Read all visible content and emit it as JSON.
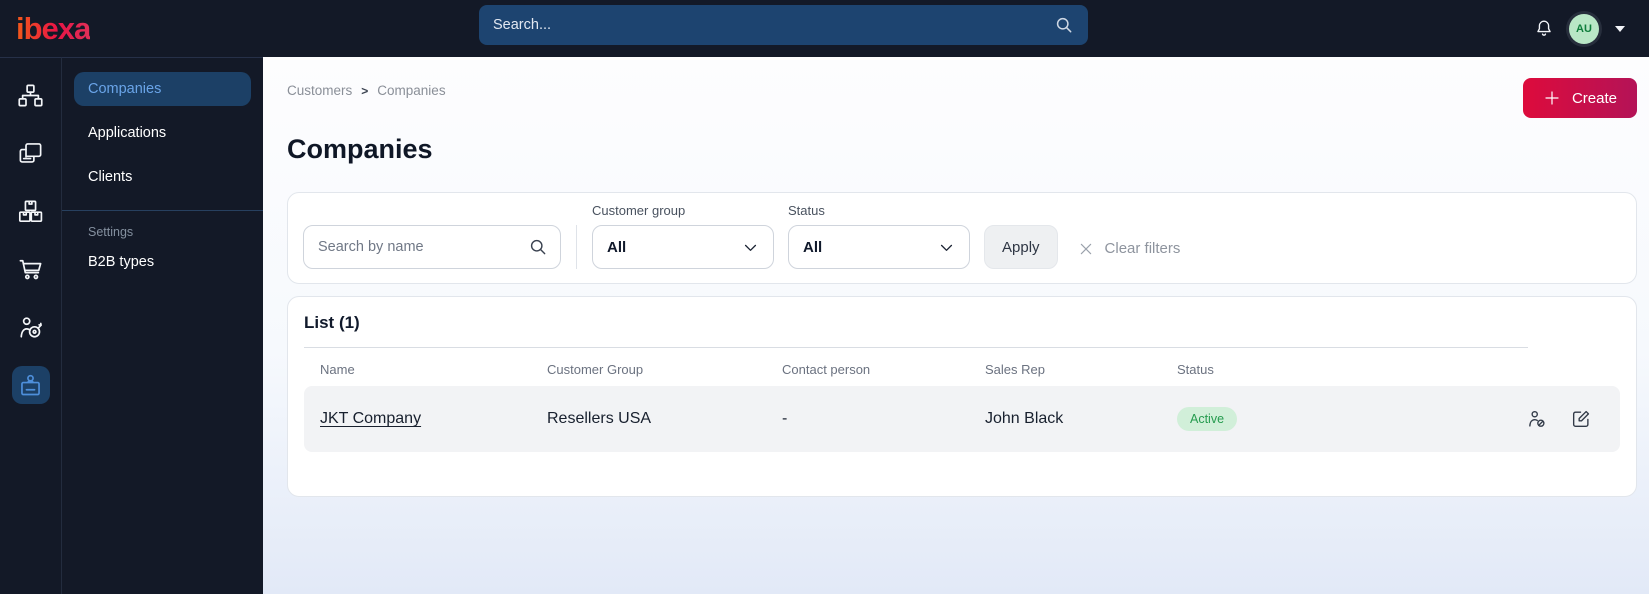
{
  "topbar": {
    "logo": "ibexa",
    "search_placeholder": "Search...",
    "avatar_initials": "AU"
  },
  "sidebar": {
    "rail_icons": [
      "sitemap",
      "pages",
      "products",
      "cart",
      "audience-target",
      "id-badge"
    ],
    "rail_active_icon": "id-badge",
    "menu_items": [
      {
        "label": "Companies",
        "active": true
      },
      {
        "label": "Applications",
        "active": false
      },
      {
        "label": "Clients",
        "active": false
      }
    ],
    "section_label": "Settings",
    "section_items": [
      {
        "label": "B2B types"
      }
    ]
  },
  "header": {
    "breadcrumb": {
      "items": [
        "Customers",
        "Companies"
      ],
      "separator": ">"
    },
    "title": "Companies",
    "create_label": "Create"
  },
  "filters": {
    "search_placeholder": "Search by name",
    "fields": [
      {
        "label": "Customer group",
        "value": "All"
      },
      {
        "label": "Status",
        "value": "All"
      }
    ],
    "apply_label": "Apply",
    "clear_label": "Clear filters"
  },
  "list": {
    "title": "List (1)",
    "columns": [
      "Name",
      "Customer Group",
      "Contact person",
      "Sales Rep",
      "Status"
    ],
    "rows": [
      {
        "name": "JKT Company",
        "customer_group": "Resellers USA",
        "contact_person": "-",
        "sales_rep": "John Black",
        "status": "Active"
      }
    ]
  },
  "colors": {
    "topbar_bg": "#131927",
    "brand_gradient": [
      "#f2541d",
      "#e81445",
      "#e03058"
    ],
    "create_gradient": [
      "#dd0b3c",
      "#b41357"
    ],
    "active_item_bg": "#1c4066",
    "active_link_text": "#6aa4e8",
    "badge_bg": "#d1efd9",
    "badge_text": "#259b4e",
    "avatar_bg": "#b9e7c6",
    "avatar_text": "#0f7d3c"
  }
}
